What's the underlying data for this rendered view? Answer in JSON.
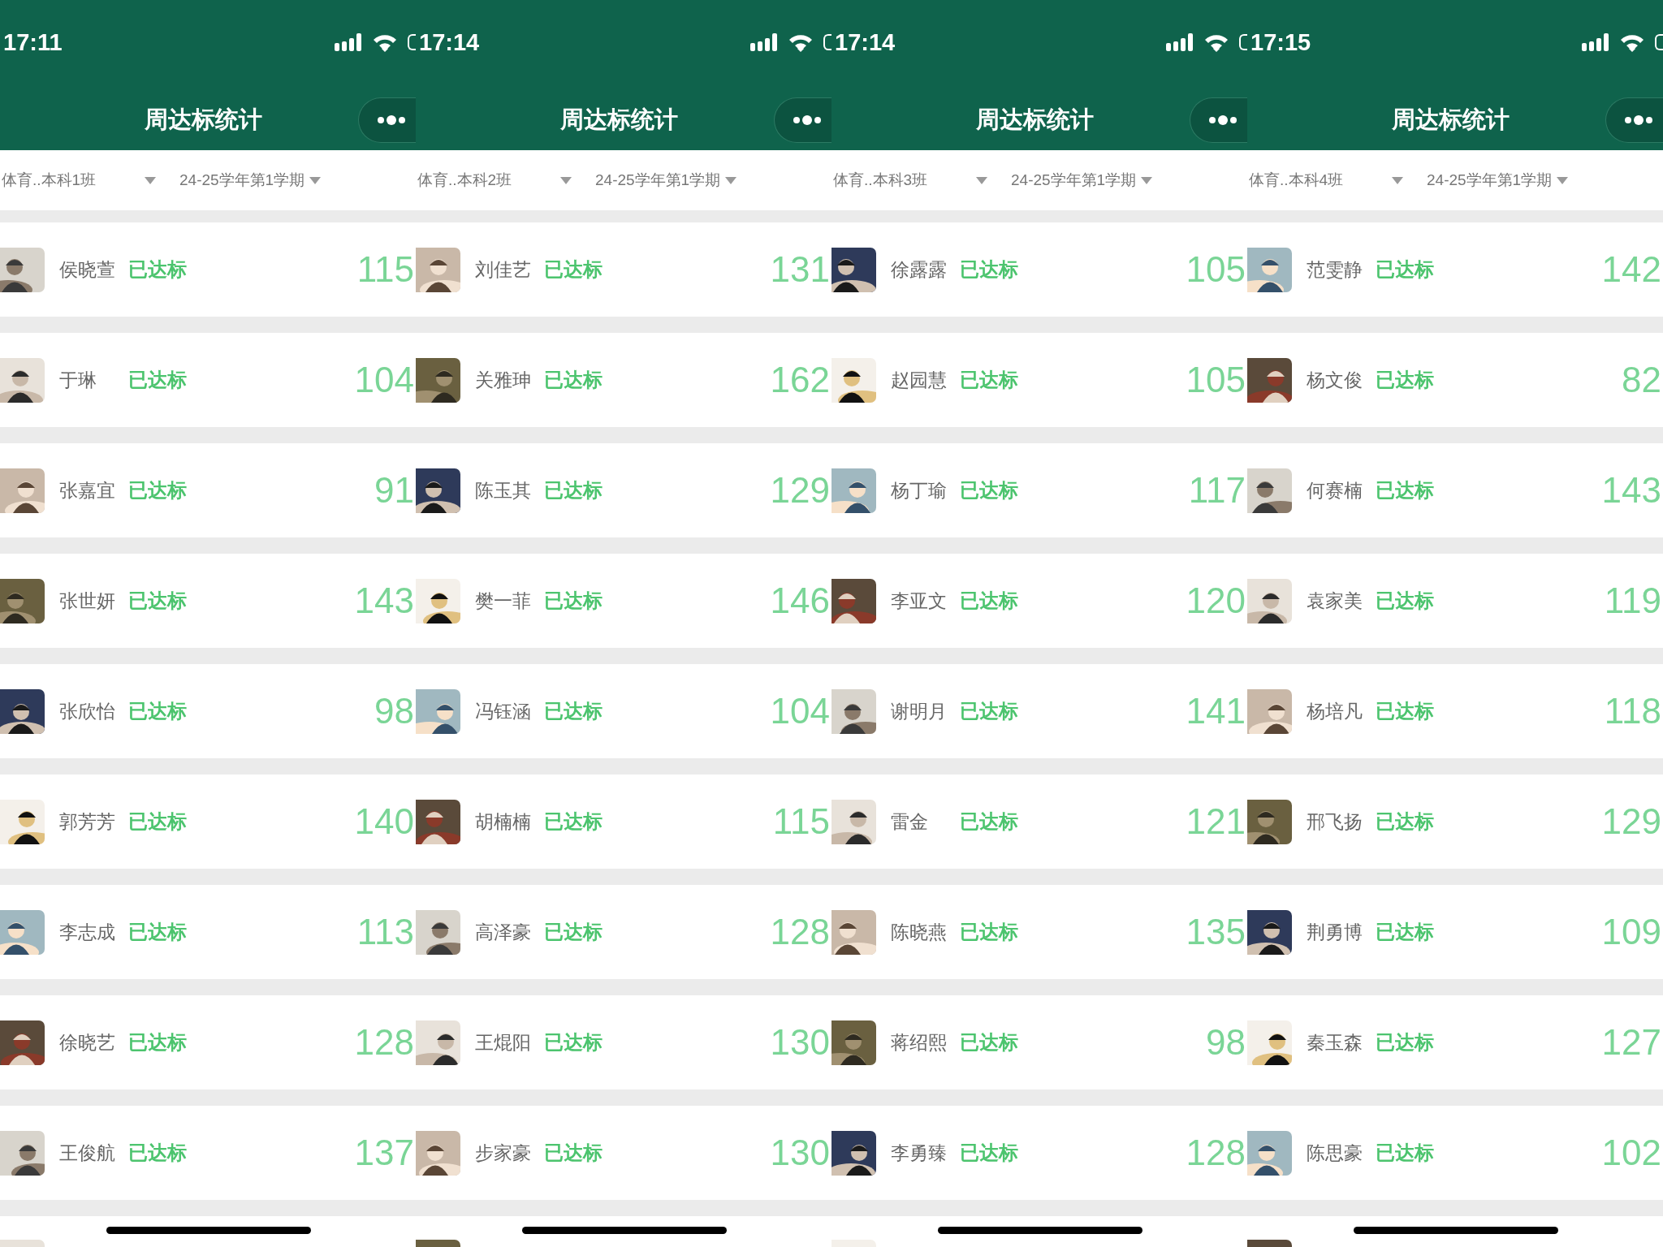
{
  "panels": [
    {
      "status_bar": {
        "time": "17:11"
      },
      "header": {
        "title": "周达标统计"
      },
      "filters": {
        "class": "体育..本科1班",
        "semester": "24-25学年第1学期"
      },
      "students": [
        {
          "name": "侯晓萱",
          "status": "已达标",
          "count": "115"
        },
        {
          "name": "于琳",
          "status": "已达标",
          "count": "104"
        },
        {
          "name": "张嘉宜",
          "status": "已达标",
          "count": "91"
        },
        {
          "name": "张世妍",
          "status": "已达标",
          "count": "143"
        },
        {
          "name": "张欣怡",
          "status": "已达标",
          "count": "98"
        },
        {
          "name": "郭芳芳",
          "status": "已达标",
          "count": "140"
        },
        {
          "name": "李志成",
          "status": "已达标",
          "count": "113"
        },
        {
          "name": "徐晓艺",
          "status": "已达标",
          "count": "128"
        },
        {
          "name": "王俊航",
          "status": "已达标",
          "count": "137"
        }
      ]
    },
    {
      "status_bar": {
        "time": "17:14"
      },
      "header": {
        "title": "周达标统计"
      },
      "filters": {
        "class": "体育..本科2班",
        "semester": "24-25学年第1学期"
      },
      "students": [
        {
          "name": "刘佳艺",
          "status": "已达标",
          "count": "131"
        },
        {
          "name": "关雅珅",
          "status": "已达标",
          "count": "162"
        },
        {
          "name": "陈玉其",
          "status": "已达标",
          "count": "129"
        },
        {
          "name": "樊一菲",
          "status": "已达标",
          "count": "146"
        },
        {
          "name": "冯钰涵",
          "status": "已达标",
          "count": "104"
        },
        {
          "name": "胡楠楠",
          "status": "已达标",
          "count": "115"
        },
        {
          "name": "高泽豪",
          "status": "已达标",
          "count": "128"
        },
        {
          "name": "王焜阳",
          "status": "已达标",
          "count": "130"
        },
        {
          "name": "步家豪",
          "status": "已达标",
          "count": "130"
        }
      ]
    },
    {
      "status_bar": {
        "time": "17:14"
      },
      "header": {
        "title": "周达标统计"
      },
      "filters": {
        "class": "体育..本科3班",
        "semester": "24-25学年第1学期"
      },
      "students": [
        {
          "name": "徐露露",
          "status": "已达标",
          "count": "105"
        },
        {
          "name": "赵园慧",
          "status": "已达标",
          "count": "105"
        },
        {
          "name": "杨丁瑜",
          "status": "已达标",
          "count": "117"
        },
        {
          "name": "李亚文",
          "status": "已达标",
          "count": "120"
        },
        {
          "name": "谢明月",
          "status": "已达标",
          "count": "141"
        },
        {
          "name": "雷金",
          "status": "已达标",
          "count": "121"
        },
        {
          "name": "陈晓燕",
          "status": "已达标",
          "count": "135"
        },
        {
          "name": "蒋绍熙",
          "status": "已达标",
          "count": "98"
        },
        {
          "name": "李勇臻",
          "status": "已达标",
          "count": "128"
        }
      ]
    },
    {
      "status_bar": {
        "time": "17:15"
      },
      "header": {
        "title": "周达标统计"
      },
      "filters": {
        "class": "体育..本科4班",
        "semester": "24-25学年第1学期"
      },
      "students": [
        {
          "name": "范雯静",
          "status": "已达标",
          "count": "142"
        },
        {
          "name": "杨文俊",
          "status": "已达标",
          "count": "82"
        },
        {
          "name": "何赛楠",
          "status": "已达标",
          "count": "143"
        },
        {
          "name": "袁家美",
          "status": "已达标",
          "count": "119"
        },
        {
          "name": "杨培凡",
          "status": "已达标",
          "count": "118"
        },
        {
          "name": "邢飞扬",
          "status": "已达标",
          "count": "129"
        },
        {
          "name": "荆勇博",
          "status": "已达标",
          "count": "109"
        },
        {
          "name": "秦玉森",
          "status": "已达标",
          "count": "127"
        },
        {
          "name": "陈思豪",
          "status": "已达标",
          "count": "102"
        }
      ]
    }
  ]
}
